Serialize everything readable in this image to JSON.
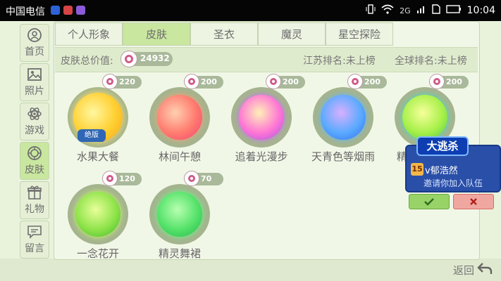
{
  "status_bar": {
    "carrier": "中国电信",
    "network": "2G",
    "time": "10:04",
    "app_icon_colors": [
      "#2e63d8",
      "#d64545",
      "#8c5ad8"
    ]
  },
  "sidebar": [
    {
      "label": "首页",
      "icon": "home-icon"
    },
    {
      "label": "照片",
      "icon": "photo-icon"
    },
    {
      "label": "游戏",
      "icon": "atom-icon"
    },
    {
      "label": "皮肤",
      "icon": "skin-icon",
      "active": true
    },
    {
      "label": "礼物",
      "icon": "gift-icon"
    },
    {
      "label": "留言",
      "icon": "message-icon"
    }
  ],
  "tabs": [
    {
      "label": "个人形象"
    },
    {
      "label": "皮肤",
      "active": true
    },
    {
      "label": "圣衣"
    },
    {
      "label": "魔灵"
    },
    {
      "label": "星空探险"
    }
  ],
  "info": {
    "total_label": "皮肤总价值:",
    "total_value": "24932",
    "jiangsu_rank": "江苏排名:未上榜",
    "global_rank": "全球排名:未上榜"
  },
  "skins": [
    {
      "name": "水果大餐",
      "price": "220",
      "color": "#ffcf30",
      "badge": "绝版"
    },
    {
      "name": "林间午憩",
      "price": "200",
      "color": "#ff7a6e"
    },
    {
      "name": "追着光漫步",
      "price": "200",
      "color": "#ff77d4"
    },
    {
      "name": "天青色等烟雨",
      "price": "200",
      "color": "#5aaaff"
    },
    {
      "name": "精灵",
      "price": "200",
      "color": "#a8f04a"
    },
    {
      "name": "一念花开",
      "price": "120",
      "color": "#8fe34a"
    },
    {
      "name": "精灵舞裙",
      "price": "70",
      "color": "#55e26a"
    }
  ],
  "invite": {
    "tag": "大逃杀",
    "level": "15",
    "name": "v郁浩然",
    "message": "邀请你加入队伍",
    "accept_icon": "check-icon",
    "decline_icon": "close-icon"
  },
  "back": {
    "label": "返回"
  },
  "colors": {
    "accent_green": "#c9e79f",
    "panel_bg": "#f1f7e7",
    "invite_blue": "#2a4fa8"
  }
}
